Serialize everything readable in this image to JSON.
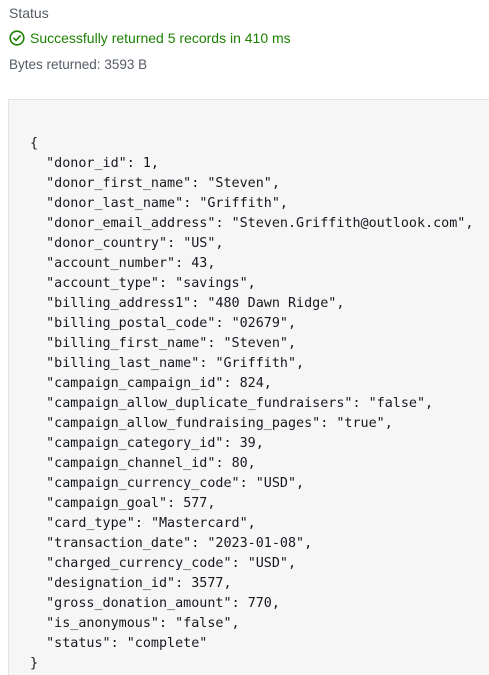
{
  "status": {
    "heading": "Status",
    "icon": "check-circle-icon",
    "success_color": "#1d8102",
    "message": "Successfully returned 5 records in 410 ms",
    "bytes_label": "Bytes returned:",
    "bytes_value": "3593 B"
  },
  "result": {
    "open_brace": "{",
    "close_brace": "}",
    "fields": [
      {
        "key": "\"donor_id\"",
        "value": "1,"
      },
      {
        "key": "\"donor_first_name\"",
        "value": "\"Steven\","
      },
      {
        "key": "\"donor_last_name\"",
        "value": "\"Griffith\","
      },
      {
        "key": "\"donor_email_address\"",
        "value": "\"Steven.Griffith@outlook.com\","
      },
      {
        "key": "\"donor_country\"",
        "value": "\"US\","
      },
      {
        "key": "\"account_number\"",
        "value": "43,"
      },
      {
        "key": "\"account_type\"",
        "value": "\"savings\","
      },
      {
        "key": "\"billing_address1\"",
        "value": "\"480 Dawn Ridge\","
      },
      {
        "key": "\"billing_postal_code\"",
        "value": "\"02679\","
      },
      {
        "key": "\"billing_first_name\"",
        "value": "\"Steven\","
      },
      {
        "key": "\"billing_last_name\"",
        "value": "\"Griffith\","
      },
      {
        "key": "\"campaign_campaign_id\"",
        "value": "824,"
      },
      {
        "key": "\"campaign_allow_duplicate_fundraisers\"",
        "value": "\"false\","
      },
      {
        "key": "\"campaign_allow_fundraising_pages\"",
        "value": "\"true\","
      },
      {
        "key": "\"campaign_category_id\"",
        "value": "39,"
      },
      {
        "key": "\"campaign_channel_id\"",
        "value": "80,"
      },
      {
        "key": "\"campaign_currency_code\"",
        "value": "\"USD\","
      },
      {
        "key": "\"campaign_goal\"",
        "value": "577,"
      },
      {
        "key": "\"card_type\"",
        "value": "\"Mastercard\","
      },
      {
        "key": "\"transaction_date\"",
        "value": "\"2023-01-08\","
      },
      {
        "key": "\"charged_currency_code\"",
        "value": "\"USD\","
      },
      {
        "key": "\"designation_id\"",
        "value": "3577,"
      },
      {
        "key": "\"gross_donation_amount\"",
        "value": "770,"
      },
      {
        "key": "\"is_anonymous\"",
        "value": "\"false\","
      },
      {
        "key": "\"status\"",
        "value": "\"complete\""
      }
    ]
  }
}
